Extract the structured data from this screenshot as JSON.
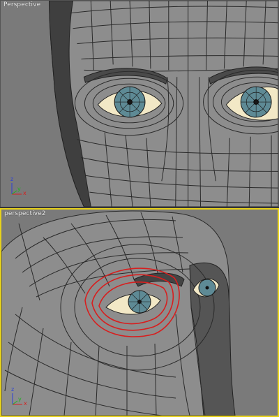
{
  "viewports": [
    {
      "label": "Perspective",
      "active": false,
      "axes": {
        "x": "x",
        "y": "y",
        "z": "z"
      }
    },
    {
      "label": "perspective2",
      "active": true,
      "axes": {
        "x": "x",
        "y": "y",
        "z": "z"
      }
    }
  ],
  "colors": {
    "viewport_bg": "#7a7a7a",
    "active_border": "#e8d21a",
    "mesh_fill": "#8d8d8d",
    "mesh_edge": "#2a2a2a",
    "selection_edge": "#d81e1e",
    "iris": "#5e8a95",
    "sclera": "#f2e8c6",
    "axis_x": "#d81e1e",
    "axis_y": "#1db31d",
    "axis_z": "#2a3fd8"
  }
}
